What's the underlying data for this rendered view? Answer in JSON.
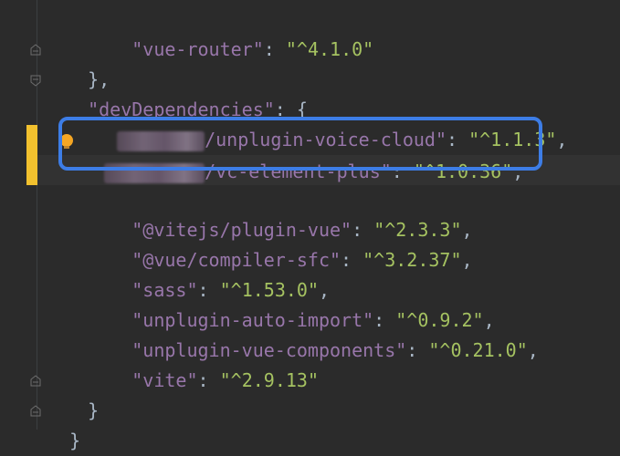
{
  "editor": {
    "lines": [
      {
        "indent": "    ",
        "key": "\"vue-router\"",
        "sep": ": ",
        "value": "\"^4.1.0\"",
        "trail": ""
      },
      {
        "indent": "  ",
        "text": "},"
      },
      {
        "indent": "  ",
        "key": "\"devDependencies\"",
        "sep": ": ",
        "text_after": "{"
      },
      {
        "indent": "    ",
        "key_blurred": "/unplugin-voice-cloud\"",
        "sep": ": ",
        "value": "\"^1.1.3\"",
        "trail": ","
      },
      {
        "indent": "    ",
        "key_blurred": "/vc-element-plus\"",
        "sep": ": ",
        "value": "\"^1.0.36\"",
        "trail": ","
      },
      {
        "indent": "",
        "text": ""
      },
      {
        "indent": "    ",
        "key": "\"@vitejs/plugin-vue\"",
        "sep": ": ",
        "value": "\"^2.3.3\"",
        "trail": ","
      },
      {
        "indent": "    ",
        "key": "\"@vue/compiler-sfc\"",
        "sep": ": ",
        "value": "\"^3.2.37\"",
        "trail": ","
      },
      {
        "indent": "    ",
        "key": "\"sass\"",
        "sep": ": ",
        "value": "\"^1.53.0\"",
        "trail": ","
      },
      {
        "indent": "    ",
        "key": "\"unplugin-auto-import\"",
        "sep": ": ",
        "value": "\"^0.9.2\"",
        "trail": ","
      },
      {
        "indent": "    ",
        "key": "\"unplugin-vue-components\"",
        "sep": ": ",
        "value": "\"^0.21.0\"",
        "trail": ","
      },
      {
        "indent": "    ",
        "key": "\"vite\"",
        "sep": ": ",
        "value": "\"^2.9.13\"",
        "trail": ""
      },
      {
        "indent": "  ",
        "text": "}"
      },
      {
        "indent": "",
        "text": "}"
      }
    ]
  },
  "colors": {
    "background": "#2b2b2b",
    "key": "#9876aa",
    "string": "#a5c261",
    "punctuation": "#a9b7c6",
    "highlight_box": "#3d7de6",
    "change_marker": "#f2c12e",
    "bulb": "#f5a623"
  }
}
